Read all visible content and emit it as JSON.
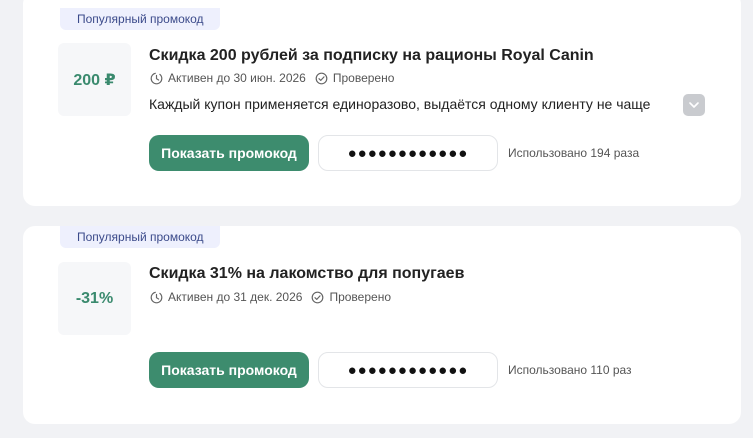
{
  "promos": [
    {
      "badge": "Популярный промокод",
      "value": "200 ₽",
      "title": "Скидка 200 рублей за подписку на рационы Royal Canin",
      "active": "Активен до 30 июн. 2026",
      "verified": "Проверено",
      "description": "Каждый купон применяется единоразово, выдаётся одному клиенту не чаще",
      "show_button": "Показать промокод",
      "code_mask": "●●●●●●●●●●●●",
      "usage": "Использовано 194 раза"
    },
    {
      "badge": "Популярный промокод",
      "value": "-31%",
      "title": "Скидка 31% на лакомство для попугаев",
      "active": "Активен до 31 дек. 2026",
      "verified": "Проверено",
      "show_button": "Показать промокод",
      "code_mask": "●●●●●●●●●●●●",
      "usage": "Использовано 110 раз"
    }
  ],
  "colors": {
    "accent_green": "#3d8c6e",
    "value_green": "#3a8a6e",
    "badge_bg": "#eef0fd",
    "badge_text": "#3b4a8a",
    "page_bg": "#f1f2f5"
  },
  "icons": {
    "active": "clock-icon",
    "verified": "check-circle-icon",
    "expand": "chevron-down-icon"
  }
}
